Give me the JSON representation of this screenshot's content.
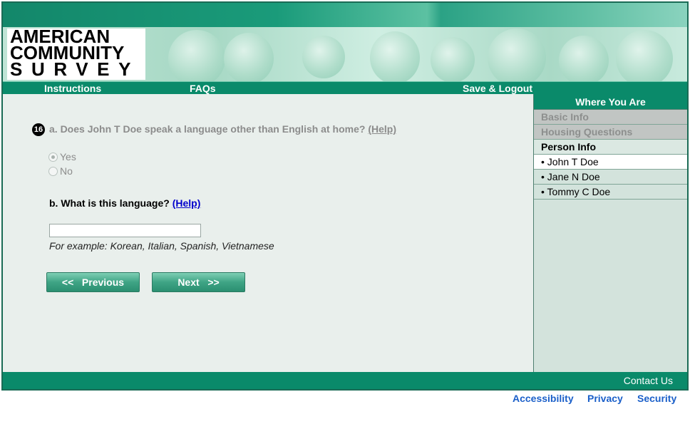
{
  "logo": {
    "line1": "AMERICAN",
    "line2": "COMMUNITY",
    "line3": "SURVEY"
  },
  "nav": {
    "instructions": "Instructions",
    "faqs": "FAQs",
    "save_logout": "Save & Logout"
  },
  "question": {
    "number": "16",
    "a_text": "a. Does John T Doe speak a language other than English at home?",
    "help_label": "(Help)",
    "options": {
      "yes": "Yes",
      "no": "No"
    },
    "selected": "yes",
    "b_text": "b. What is this language?",
    "b_help_label": "(Help)",
    "language_value": "",
    "example": "For example: Korean, Italian, Spanish, Vietnamese"
  },
  "buttons": {
    "previous": "<<   Previous",
    "next": "Next   >>"
  },
  "sidebar": {
    "title": "Where You Are",
    "items": [
      {
        "label": "Basic Info",
        "state": "disabled"
      },
      {
        "label": "Housing Questions",
        "state": "disabled"
      },
      {
        "label": "Person Info",
        "state": "header"
      },
      {
        "label": "• John T Doe",
        "state": "current"
      },
      {
        "label": "• Jane N Doe",
        "state": "link"
      },
      {
        "label": "• Tommy C Doe",
        "state": "link"
      }
    ]
  },
  "footer": {
    "contact": "Contact Us",
    "accessibility": "Accessibility",
    "privacy": "Privacy",
    "security": "Security"
  },
  "colors": {
    "brand_green": "#0a8a6a",
    "link_blue": "#1a5fc9"
  }
}
